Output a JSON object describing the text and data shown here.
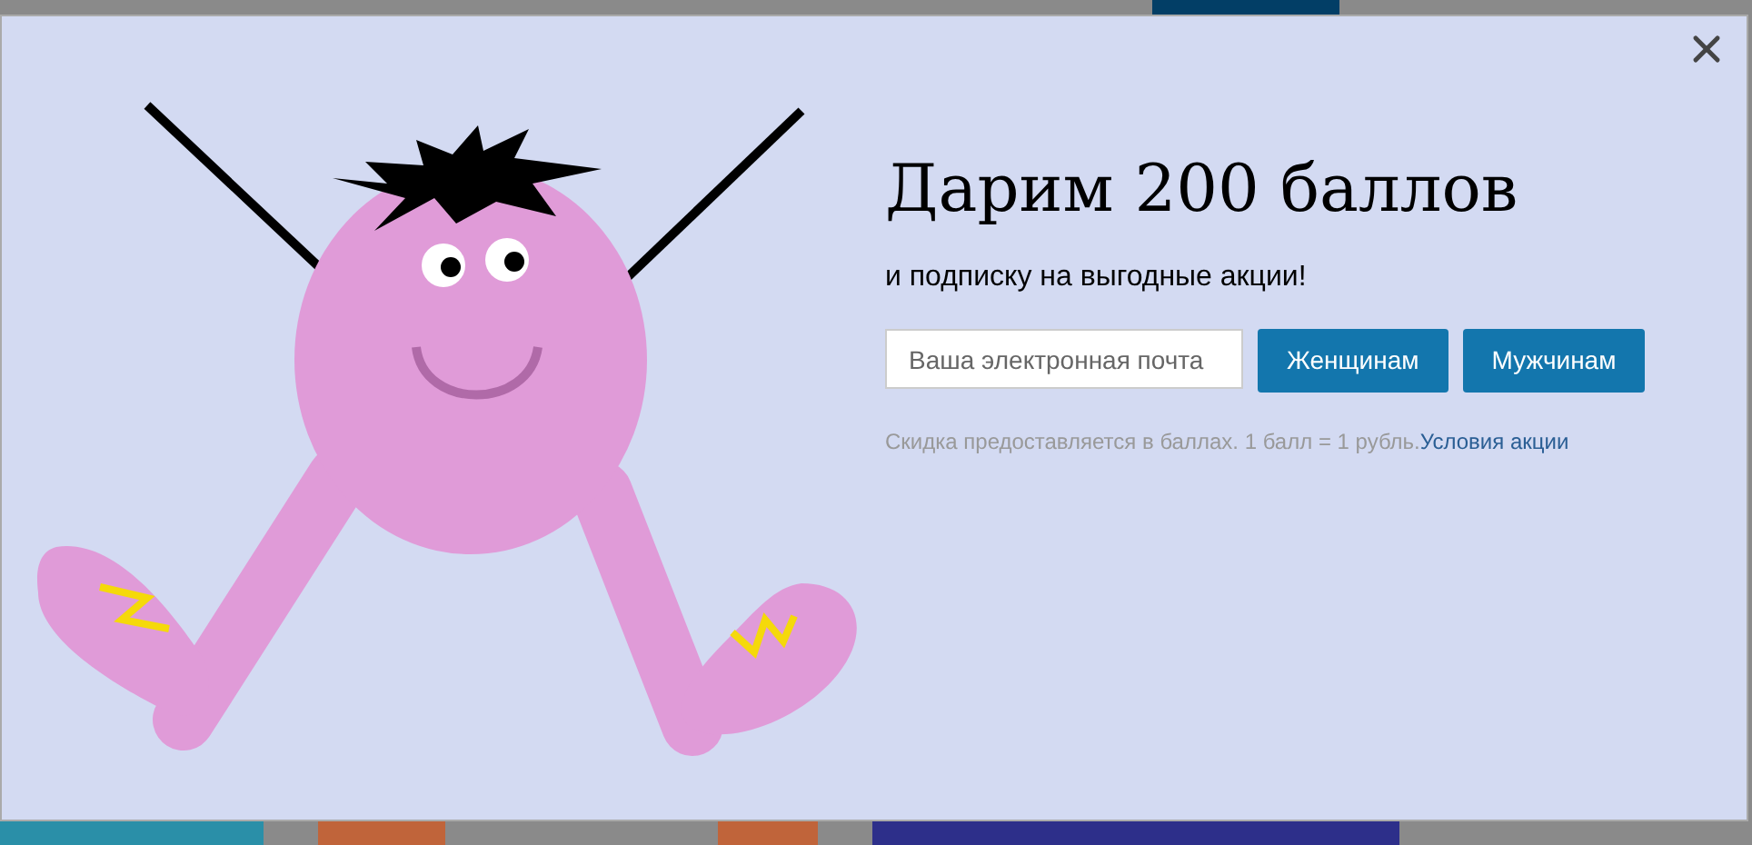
{
  "modal": {
    "title": "Дарим 200 баллов",
    "subtitle": "и подписку на выгодные акции!",
    "email_field": {
      "placeholder": "Ваша электронная почта"
    },
    "buttons": [
      {
        "label": "Женщинам"
      },
      {
        "label": "Мужчинам"
      }
    ],
    "note": {
      "text": "Скидка предоставляется в баллах. 1 балл = 1 рубль.",
      "link": "Условия акции"
    }
  }
}
